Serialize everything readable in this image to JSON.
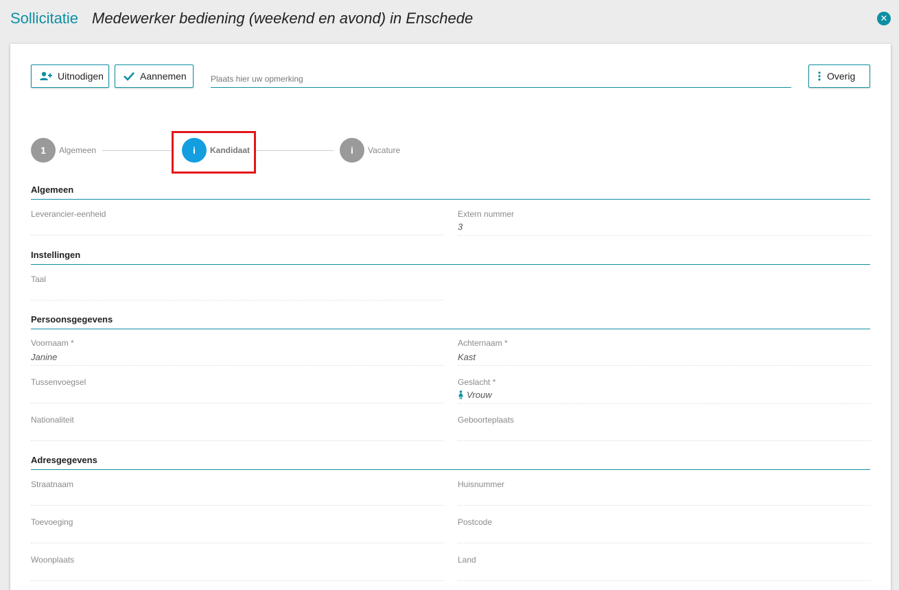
{
  "header": {
    "app_title": "Sollicitatie",
    "doc_title": "Medewerker bediening (weekend en avond) in Enschede",
    "close_icon": "close-circle-icon"
  },
  "toolbar": {
    "invite_label": "Uitnodigen",
    "invite_icon": "add-user-icon",
    "hire_label": "Aannemen",
    "hire_icon": "check-icon",
    "remark_placeholder": "Plaats hier uw opmerking",
    "remark_value": "",
    "more_label": "Overig",
    "more_icon": "vertical-dots-icon"
  },
  "steps": [
    {
      "badge": "1",
      "label": "Algemeen",
      "state": "done"
    },
    {
      "badge": "i",
      "label": "Kandidaat",
      "state": "active"
    },
    {
      "badge": "i",
      "label": "Vacature",
      "state": "inactive"
    }
  ],
  "sections": {
    "algemeen": {
      "title": "Algemeen",
      "supplier_unit": {
        "label": "Leverancier-eenheid",
        "value": ""
      },
      "external_number": {
        "label": "Extern nummer",
        "value": "3"
      }
    },
    "instellingen": {
      "title": "Instellingen",
      "language": {
        "label": "Taal",
        "value": ""
      }
    },
    "persoonsgegevens": {
      "title": "Persoonsgegevens",
      "first_name": {
        "label": "Voornaam *",
        "value": "Janine"
      },
      "last_name": {
        "label": "Achternaam *",
        "value": "Kast"
      },
      "infix": {
        "label": "Tussenvoegsel",
        "value": ""
      },
      "gender": {
        "label": "Geslacht *",
        "value": "Vrouw",
        "icon": "female-icon"
      },
      "nationality": {
        "label": "Nationaliteit",
        "value": ""
      },
      "birthplace": {
        "label": "Geboorteplaats",
        "value": ""
      }
    },
    "adresgegevens": {
      "title": "Adresgegevens",
      "street": {
        "label": "Straatnaam",
        "value": ""
      },
      "house_number": {
        "label": "Huisnummer",
        "value": ""
      },
      "addition": {
        "label": "Toevoeging",
        "value": ""
      },
      "postcode": {
        "label": "Postcode",
        "value": ""
      },
      "city": {
        "label": "Woonplaats",
        "value": ""
      },
      "country": {
        "label": "Land",
        "value": ""
      }
    }
  },
  "colors": {
    "accent": "#0e8fa3",
    "active_step": "#139ee0",
    "inactive_step": "#9a9a9a",
    "highlight": "#e3151a"
  }
}
